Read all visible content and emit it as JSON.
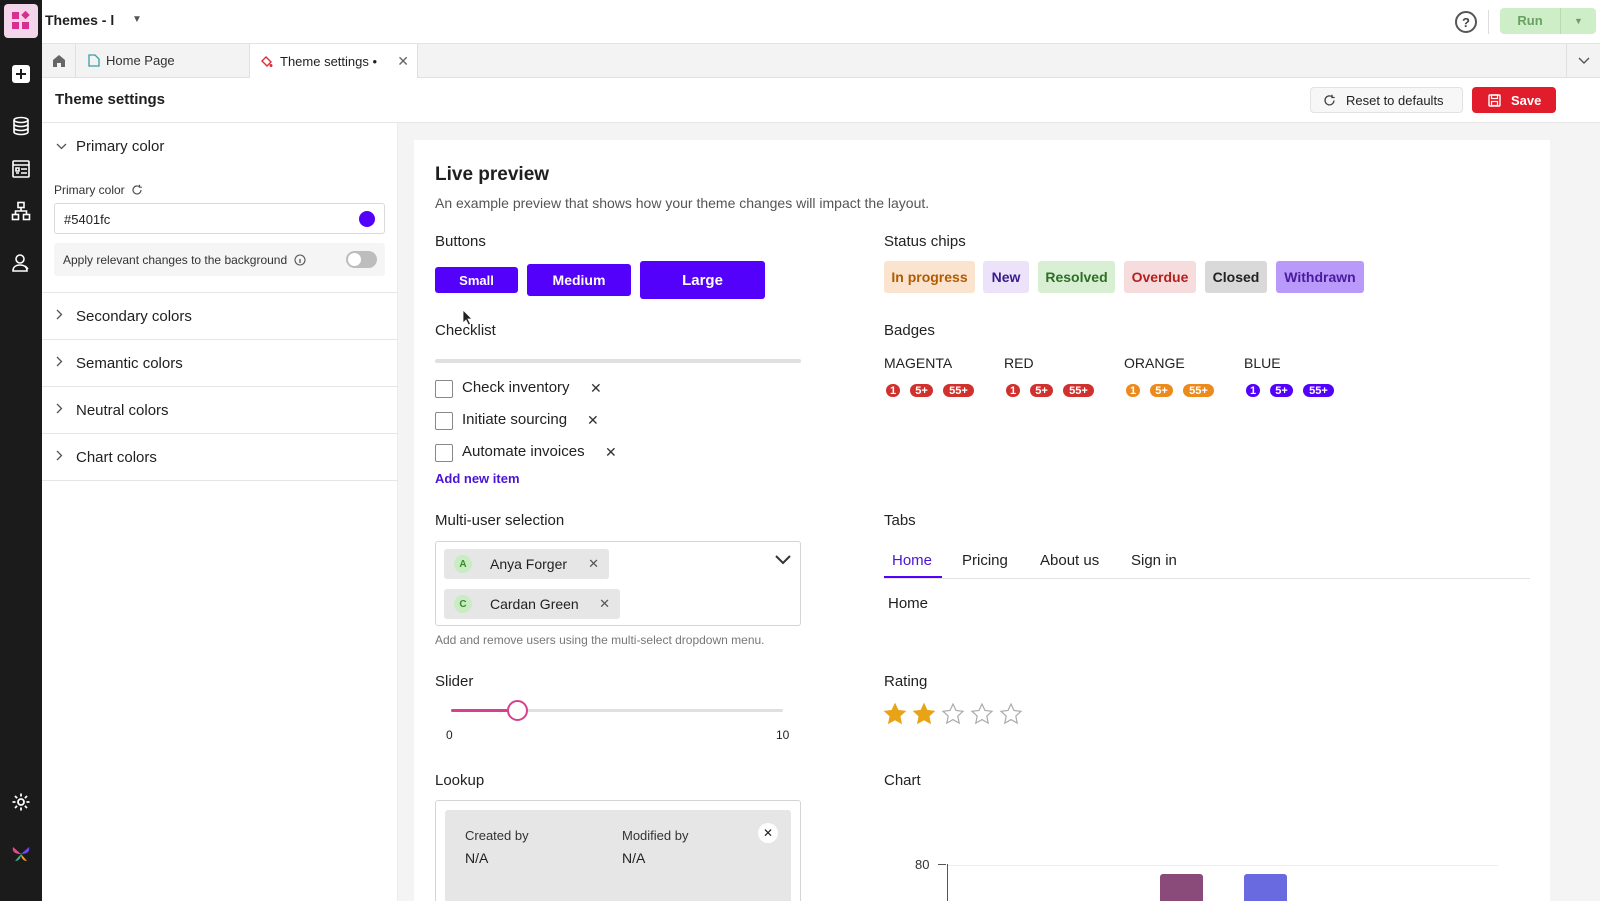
{
  "app": {
    "title": "Themes - l"
  },
  "topbar": {
    "run_label": "Run",
    "help_label": "?"
  },
  "tabs": {
    "home": "Home Page",
    "theme": "Theme settings •"
  },
  "header": {
    "title": "Theme settings",
    "reset_label": "Reset to defaults",
    "save_label": "Save"
  },
  "sections": {
    "primary": "Primary color",
    "secondary": "Secondary colors",
    "semantic": "Semantic colors",
    "neutral": "Neutral colors",
    "chart": "Chart colors"
  },
  "primary_color": {
    "label": "Primary color",
    "value": "#5401fc",
    "bg_label": "Apply relevant changes to the background",
    "bg_toggle": false
  },
  "preview": {
    "title": "Live preview",
    "subtitle": "An example preview that shows how your theme changes will impact the layout.",
    "buttons": {
      "heading": "Buttons",
      "small": "Small",
      "medium": "Medium",
      "large": "Large"
    },
    "status_chips": {
      "heading": "Status chips",
      "items": [
        {
          "label": "In progress",
          "bg": "#fbe4cf",
          "fg": "#b35a00"
        },
        {
          "label": "New",
          "bg": "#ece3fa",
          "fg": "#3b1a8f"
        },
        {
          "label": "Resolved",
          "bg": "#d8efd4",
          "fg": "#2e6e27"
        },
        {
          "label": "Overdue",
          "bg": "#f6dcdc",
          "fg": "#b22020"
        },
        {
          "label": "Closed",
          "bg": "#d9d9d9",
          "fg": "#222222"
        },
        {
          "label": "Withdrawn",
          "bg": "#b99afa",
          "fg": "#4a1a9e"
        }
      ]
    },
    "checklist": {
      "heading": "Checklist",
      "items": [
        "Check inventory",
        "Initiate sourcing",
        "Automate invoices"
      ],
      "add_label": "Add new item",
      "progress": 0
    },
    "badges": {
      "heading": "Badges",
      "groups": [
        {
          "label": "MAGENTA",
          "color": "#d0312d",
          "values": [
            "1",
            "5+",
            "55+"
          ]
        },
        {
          "label": "RED",
          "color": "#d0312d",
          "values": [
            "1",
            "5+",
            "55+"
          ]
        },
        {
          "label": "ORANGE",
          "color": "#ec8a1c",
          "values": [
            "1",
            "5+",
            "55+"
          ]
        },
        {
          "label": "BLUE",
          "color": "#5401fc",
          "values": [
            "1",
            "5+",
            "55+"
          ]
        }
      ]
    },
    "multiuser": {
      "heading": "Multi-user selection",
      "users": [
        {
          "initial": "A",
          "name": "Anya Forger"
        },
        {
          "initial": "C",
          "name": "Cardan Green"
        }
      ],
      "help": "Add and remove users using the multi-select dropdown menu."
    },
    "tabs": {
      "heading": "Tabs",
      "items": [
        "Home",
        "Pricing",
        "About us",
        "Sign in"
      ],
      "active": "Home",
      "content": "Home"
    },
    "slider": {
      "heading": "Slider",
      "min": "0",
      "max": "10",
      "value": 2
    },
    "rating": {
      "heading": "Rating",
      "value": 2,
      "max": 5
    },
    "lookup": {
      "heading": "Lookup",
      "created_label": "Created by",
      "created_value": "N/A",
      "modified_label": "Modified by",
      "modified_value": "N/A"
    },
    "chart": {
      "heading": "Chart",
      "y_tick": "80"
    }
  },
  "colors": {
    "primary": "#5401fc",
    "save": "#e11d2b",
    "slider": "#d6408f"
  }
}
